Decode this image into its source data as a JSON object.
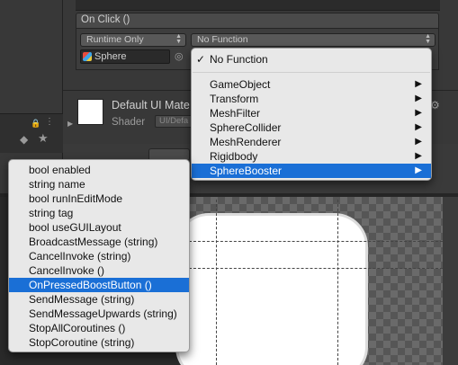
{
  "onclick": {
    "title": "On Click ()",
    "runtime_option": "Runtime Only",
    "function_value": "No Function",
    "target_object": "Sphere"
  },
  "material": {
    "name": "Default UI Mate",
    "shader_label": "Shader",
    "shader_value": "UI/Defa"
  },
  "function_menu": {
    "checked_item": "No Function",
    "items": [
      {
        "label": "GameObject",
        "submenu": true
      },
      {
        "label": "Transform",
        "submenu": true
      },
      {
        "label": "MeshFilter",
        "submenu": true
      },
      {
        "label": "SphereCollider",
        "submenu": true
      },
      {
        "label": "MeshRenderer",
        "submenu": true
      },
      {
        "label": "Rigidbody",
        "submenu": true
      },
      {
        "label": "SphereBooster",
        "submenu": true,
        "selected": true
      }
    ]
  },
  "method_menu": {
    "items": [
      {
        "label": "bool enabled"
      },
      {
        "label": "string name"
      },
      {
        "label": "bool runInEditMode"
      },
      {
        "label": "string tag"
      },
      {
        "label": "bool useGUILayout"
      },
      {
        "label": "BroadcastMessage (string)"
      },
      {
        "label": "CancelInvoke (string)"
      },
      {
        "label": "CancelInvoke ()"
      },
      {
        "label": "OnPressedBoostButton ()",
        "selected": true
      },
      {
        "label": "SendMessage (string)"
      },
      {
        "label": "SendMessageUpwards (string)"
      },
      {
        "label": "StopAllCoroutines ()"
      },
      {
        "label": "StopCoroutine (string)"
      }
    ]
  },
  "colors": {
    "selection": "#1a6fd6",
    "menu_background": "#e8e8e8",
    "panel": "#383838"
  },
  "icons": {
    "check": "✓",
    "submenu_arrow": "▶",
    "gear": "⚙",
    "lock": "🔒",
    "tag": "◆",
    "star": "★",
    "target": "◎"
  }
}
